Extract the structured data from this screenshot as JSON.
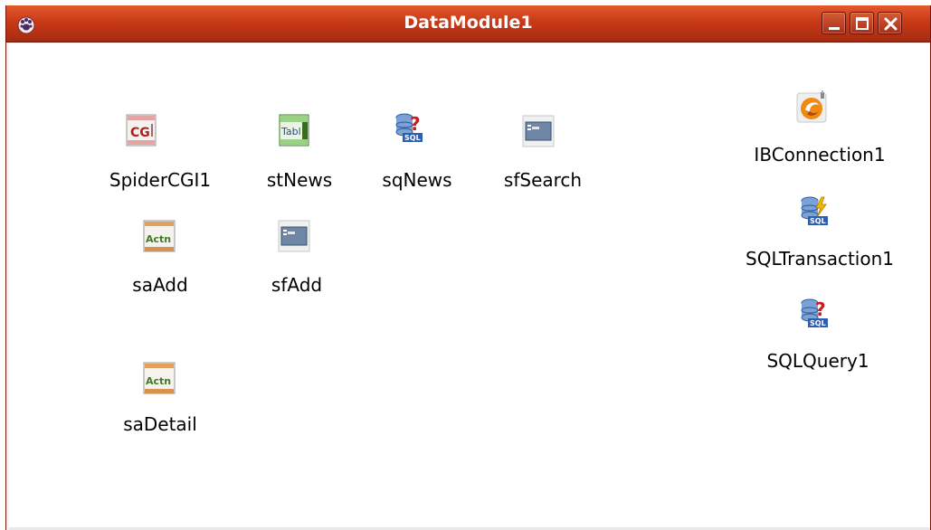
{
  "window": {
    "title": "DataModule1",
    "app_icon": "lazarus-paw-icon",
    "buttons": {
      "minimize": "minimize-icon",
      "maximize": "maximize-icon",
      "close": "close-icon"
    },
    "colors": {
      "titlebar": "#c83a17",
      "background": "#ffffff"
    }
  },
  "components": [
    {
      "name": "SpiderCGI1",
      "icon": "cgi-icon"
    },
    {
      "name": "stNews",
      "icon": "table-icon"
    },
    {
      "name": "sqNews",
      "icon": "sql-query-icon"
    },
    {
      "name": "sfSearch",
      "icon": "form-icon"
    },
    {
      "name": "saAdd",
      "icon": "action-icon"
    },
    {
      "name": "sfAdd",
      "icon": "form-icon"
    },
    {
      "name": "saDetail",
      "icon": "action-icon"
    },
    {
      "name": "IBConnection1",
      "icon": "firebird-connection-icon"
    },
    {
      "name": "SQLTransaction1",
      "icon": "sql-transaction-icon"
    },
    {
      "name": "SQLQuery1",
      "icon": "sql-query-icon"
    }
  ]
}
